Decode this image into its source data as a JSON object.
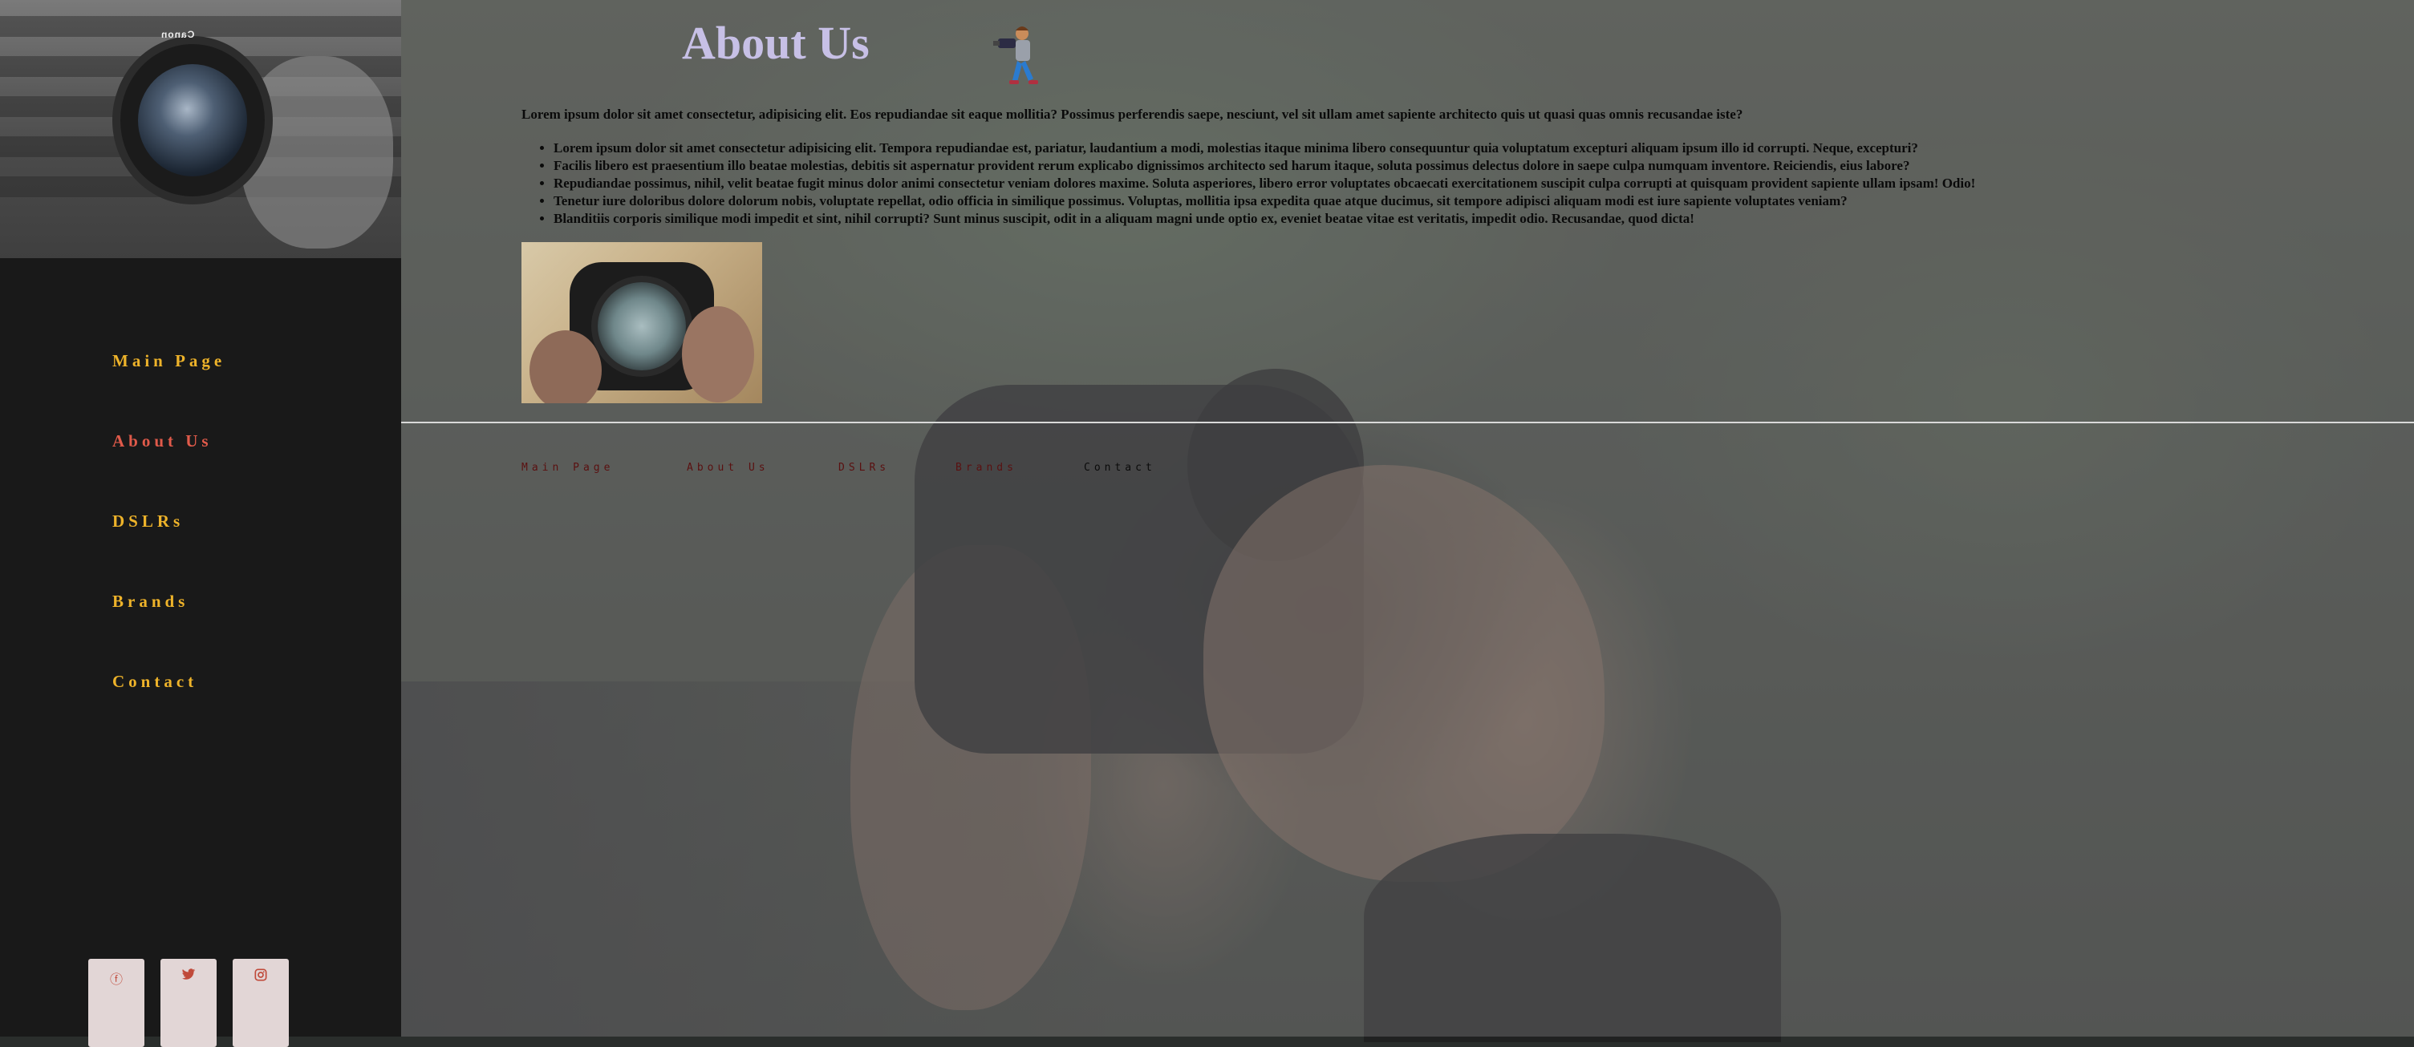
{
  "sidebar": {
    "nav": [
      {
        "label": "Main Page"
      },
      {
        "label": "About Us"
      },
      {
        "label": "DSLRs"
      },
      {
        "label": "Brands"
      },
      {
        "label": "Contact"
      }
    ],
    "active_nav": "About Us",
    "photo_brand_text": "Canon",
    "social": [
      {
        "icon": "facebook-icon",
        "glyph": "ⓕ"
      },
      {
        "icon": "twitter-icon",
        "glyph": "🐦"
      },
      {
        "icon": "instagram-icon",
        "glyph": "◫"
      }
    ]
  },
  "main": {
    "title": "About Us",
    "intro": "Lorem ipsum dolor sit amet consectetur, adipisicing elit. Eos repudiandae sit eaque mollitia? Possimus perferendis saepe, nesciunt, vel sit ullam amet sapiente architecto quis ut quasi quas omnis recusandae iste?",
    "list": [
      "Lorem ipsum dolor sit amet consectetur adipisicing elit. Tempora repudiandae est, pariatur, laudantium a modi, molestias itaque minima libero consequuntur quia voluptatum excepturi aliquam ipsum illo id corrupti. Neque, excepturi?",
      "Facilis libero est praesentium illo beatae molestias, debitis sit aspernatur provident rerum explicabo dignissimos architecto sed harum itaque, soluta possimus delectus dolore in saepe culpa numquam inventore. Reiciendis, eius labore?",
      "Repudiandae possimus, nihil, velit beatae fugit minus dolor animi consectetur veniam dolores maxime. Soluta asperiores, libero error voluptates obcaecati exercitationem suscipit culpa corrupti at quisquam provident sapiente ullam ipsam! Odio!",
      "Tenetur iure doloribus dolore dolorum nobis, voluptate repellat, odio officia in similique possimus. Voluptas, mollitia ipsa expedita quae atque ducimus, sit tempore adipisci aliquam modi est iure sapiente voluptates veniam?",
      "Blanditiis corporis similique modi impedit et sint, nihil corrupti? Sunt minus suscipit, odit in a aliquam magni unde optio ex, eveniet beatae vitae est veritatis, impedit odio. Recusandae, quod dicta!"
    ]
  },
  "footer": {
    "nav": [
      {
        "label": "Main Page"
      },
      {
        "label": "About Us"
      },
      {
        "label": "DSLRs"
      },
      {
        "label": "Brands"
      },
      {
        "label": "Contact"
      }
    ]
  },
  "colors": {
    "nav_text": "#eeb32a",
    "nav_active": "#e05a4a",
    "title": "#c7c0e6",
    "sidebar_bg": "#191919",
    "footer_link": "#5a1010"
  }
}
